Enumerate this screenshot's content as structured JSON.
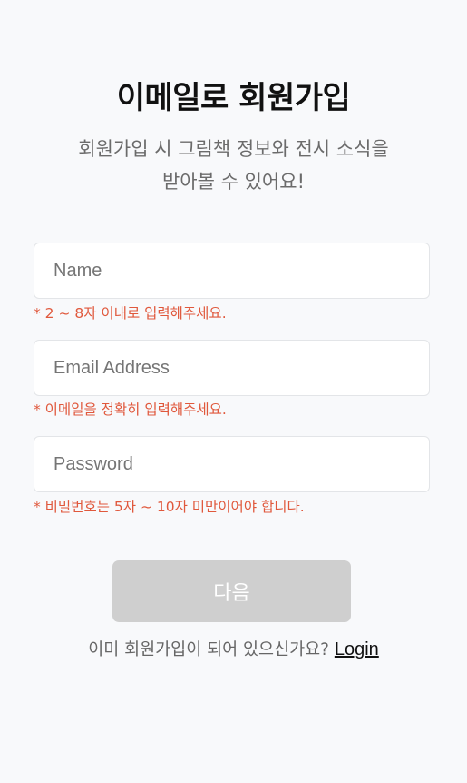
{
  "header": {
    "title": "이메일로 회원가입",
    "subtitle_line1": "회원가입 시 그림책 정보와 전시 소식을",
    "subtitle_line2": "받아볼 수 있어요!"
  },
  "form": {
    "name": {
      "placeholder": "Name",
      "value": "",
      "hint": "* 2 ~ 8자 이내로 입력해주세요."
    },
    "email": {
      "placeholder": "Email Address",
      "value": "",
      "hint": "* 이메일을 정확히 입력해주세요."
    },
    "password": {
      "placeholder": "Password",
      "value": "",
      "hint": "* 비밀번호는 5자 ~ 10자 미만이어야 합니다."
    },
    "next_label": "다음"
  },
  "footer": {
    "prompt": "이미 회원가입이 되어 있으신가요?",
    "login_label": "Login"
  },
  "colors": {
    "background": "#f8f9fb",
    "hint": "#e0583c",
    "button_disabled": "#cfcfcf"
  }
}
